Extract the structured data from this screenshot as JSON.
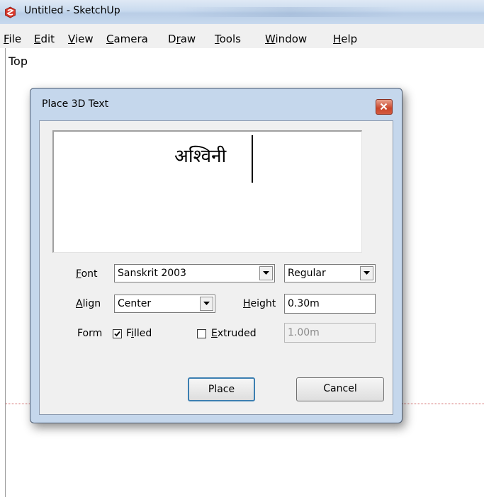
{
  "window": {
    "title": "Untitled - SketchUp"
  },
  "menu": {
    "items": [
      {
        "mnemonic": "F",
        "rest": "ile"
      },
      {
        "mnemonic": "E",
        "rest": "dit"
      },
      {
        "mnemonic": "V",
        "rest": "iew"
      },
      {
        "mnemonic": "C",
        "rest": "amera"
      },
      {
        "pre": "D",
        "mnemonic": "r",
        "rest": "aw"
      },
      {
        "mnemonic": "T",
        "rest": "ools"
      },
      {
        "mnemonic": "W",
        "rest": "indow"
      },
      {
        "mnemonic": "H",
        "rest": "elp"
      }
    ]
  },
  "viewport": {
    "view_label": "Top"
  },
  "dialog": {
    "title": "Place 3D Text",
    "text_value": "अश्विनी",
    "font": {
      "mnemonic": "F",
      "rest": "ont",
      "value": "Sanskrit 2003",
      "style": "Regular"
    },
    "align": {
      "mnemonic": "A",
      "rest": "lign",
      "value": "Center"
    },
    "height": {
      "mnemonic": "H",
      "rest": "eight",
      "value": "0.30m"
    },
    "form": {
      "label": "Form",
      "filled": {
        "pre": "F",
        "mnemonic": "i",
        "rest": "lled",
        "checked": true
      },
      "extruded": {
        "mnemonic": "E",
        "rest": "xtruded",
        "checked": false,
        "value": "1.00m"
      }
    },
    "buttons": {
      "place": "Place",
      "cancel": "Cancel"
    }
  },
  "colors": {
    "titlebar": "#c9daee",
    "dialog_frame": "#c5d7ec",
    "close_button": "#c9452a",
    "axis_red": "#d06060"
  }
}
